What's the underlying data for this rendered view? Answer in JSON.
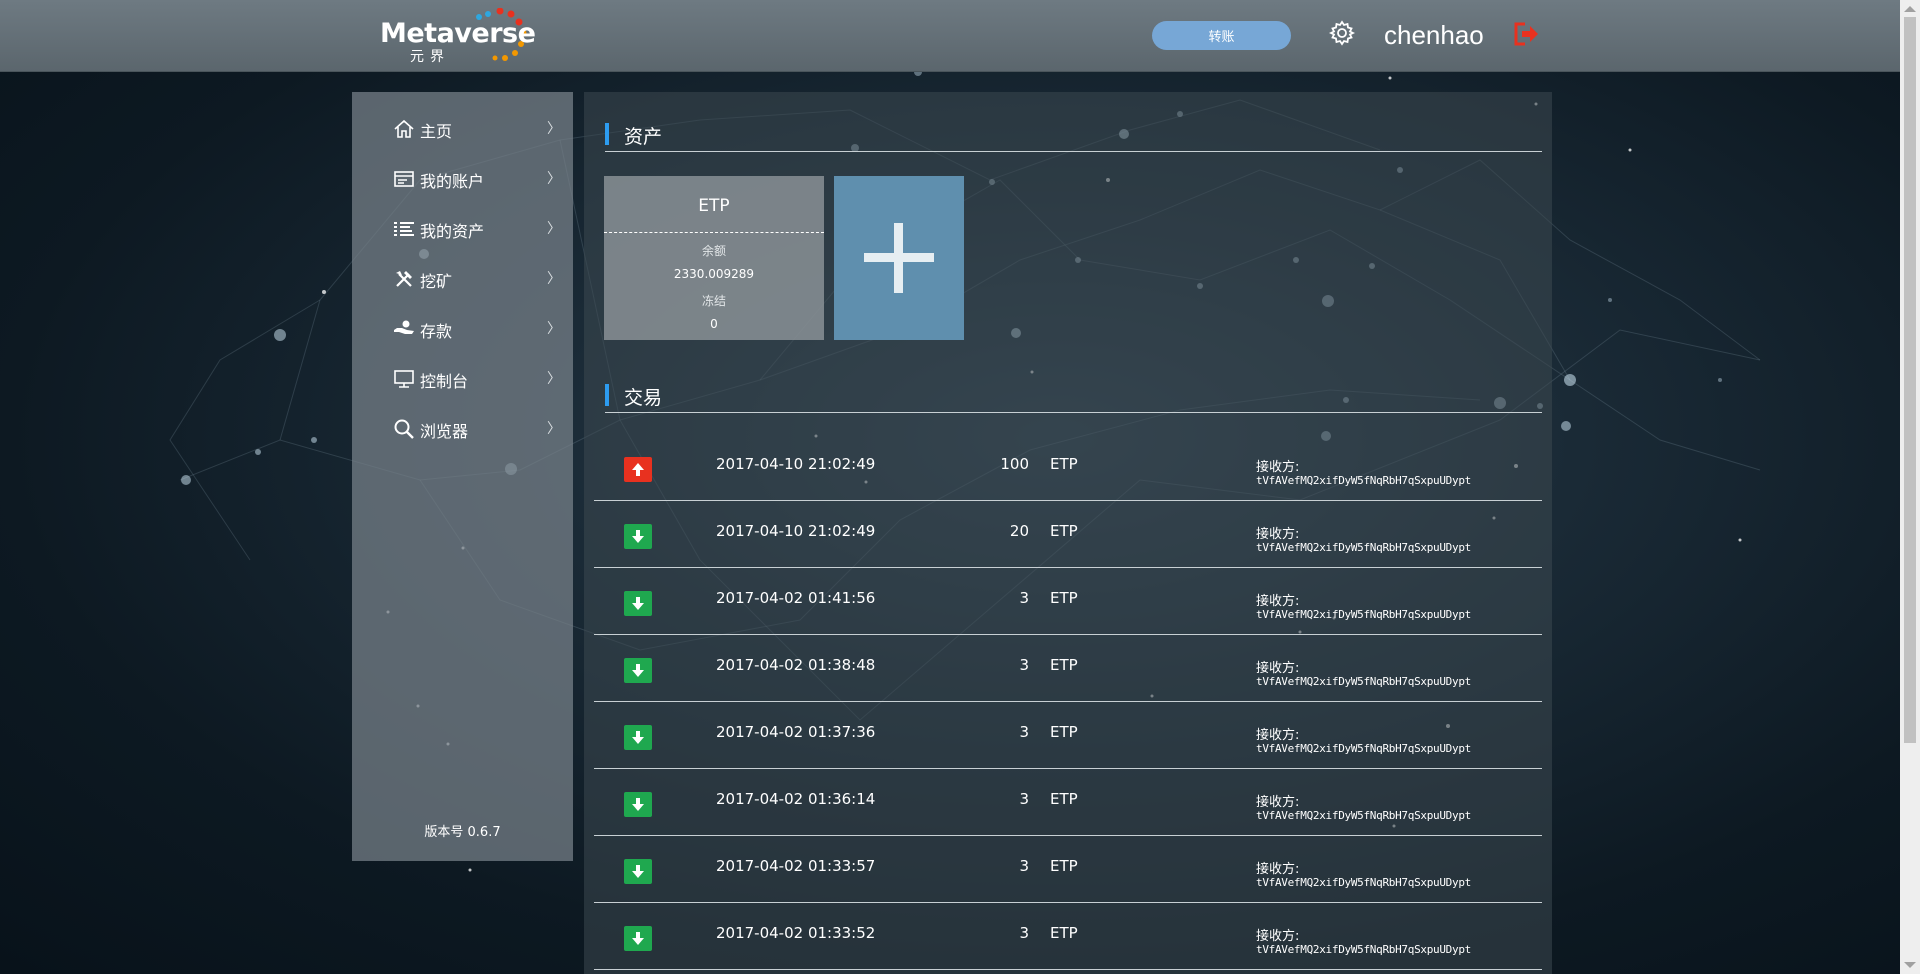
{
  "header": {
    "logo_text": "Metaverse",
    "logo_sub": "元界",
    "transfer_label": "转账",
    "username": "chenhao"
  },
  "sidebar": {
    "items": [
      {
        "label": "主页",
        "icon": "home-icon"
      },
      {
        "label": "我的账户",
        "icon": "account-card-icon"
      },
      {
        "label": "我的资产",
        "icon": "assets-list-icon"
      },
      {
        "label": "挖矿",
        "icon": "tools-icon"
      },
      {
        "label": "存款",
        "icon": "hand-deposit-icon"
      },
      {
        "label": "控制台",
        "icon": "monitor-icon"
      },
      {
        "label": "浏览器",
        "icon": "search-icon"
      }
    ],
    "chevron": "〉",
    "version": "版本号 0.6.7"
  },
  "assets": {
    "title": "资产",
    "cards": [
      {
        "name": "ETP",
        "balance_label": "余额",
        "balance": "2330.009289",
        "frozen_label": "冻结",
        "frozen": "0"
      }
    ],
    "add_symbol": "plus-icon"
  },
  "transactions": {
    "title": "交易",
    "rows": [
      {
        "direction": "out",
        "time": "2017-04-10 21:02:49",
        "amount": "100",
        "unit": "ETP",
        "to_label": "接收方:",
        "address": "tVfAVefMQ2xifDyW5fNqRbH7qSxpuUDypt"
      },
      {
        "direction": "in",
        "time": "2017-04-10 21:02:49",
        "amount": "20",
        "unit": "ETP",
        "to_label": "接收方:",
        "address": "tVfAVefMQ2xifDyW5fNqRbH7qSxpuUDypt"
      },
      {
        "direction": "in",
        "time": "2017-04-02 01:41:56",
        "amount": "3",
        "unit": "ETP",
        "to_label": "接收方:",
        "address": "tVfAVefMQ2xifDyW5fNqRbH7qSxpuUDypt"
      },
      {
        "direction": "in",
        "time": "2017-04-02 01:38:48",
        "amount": "3",
        "unit": "ETP",
        "to_label": "接收方:",
        "address": "tVfAVefMQ2xifDyW5fNqRbH7qSxpuUDypt"
      },
      {
        "direction": "in",
        "time": "2017-04-02 01:37:36",
        "amount": "3",
        "unit": "ETP",
        "to_label": "接收方:",
        "address": "tVfAVefMQ2xifDyW5fNqRbH7qSxpuUDypt"
      },
      {
        "direction": "in",
        "time": "2017-04-02 01:36:14",
        "amount": "3",
        "unit": "ETP",
        "to_label": "接收方:",
        "address": "tVfAVefMQ2xifDyW5fNqRbH7qSxpuUDypt"
      },
      {
        "direction": "in",
        "time": "2017-04-02 01:33:57",
        "amount": "3",
        "unit": "ETP",
        "to_label": "接收方:",
        "address": "tVfAVefMQ2xifDyW5fNqRbH7qSxpuUDypt"
      },
      {
        "direction": "in",
        "time": "2017-04-02 01:33:52",
        "amount": "3",
        "unit": "ETP",
        "to_label": "接收方:",
        "address": "tVfAVefMQ2xifDyW5fNqRbH7qSxpuUDypt"
      }
    ]
  },
  "colors": {
    "accent": "#2d9cf0",
    "transfer_button": "#77a7d6",
    "outgoing": "#e8311f",
    "incoming": "#1fa84f",
    "add_card": "#5f8fae",
    "logout": "#e8311f"
  }
}
